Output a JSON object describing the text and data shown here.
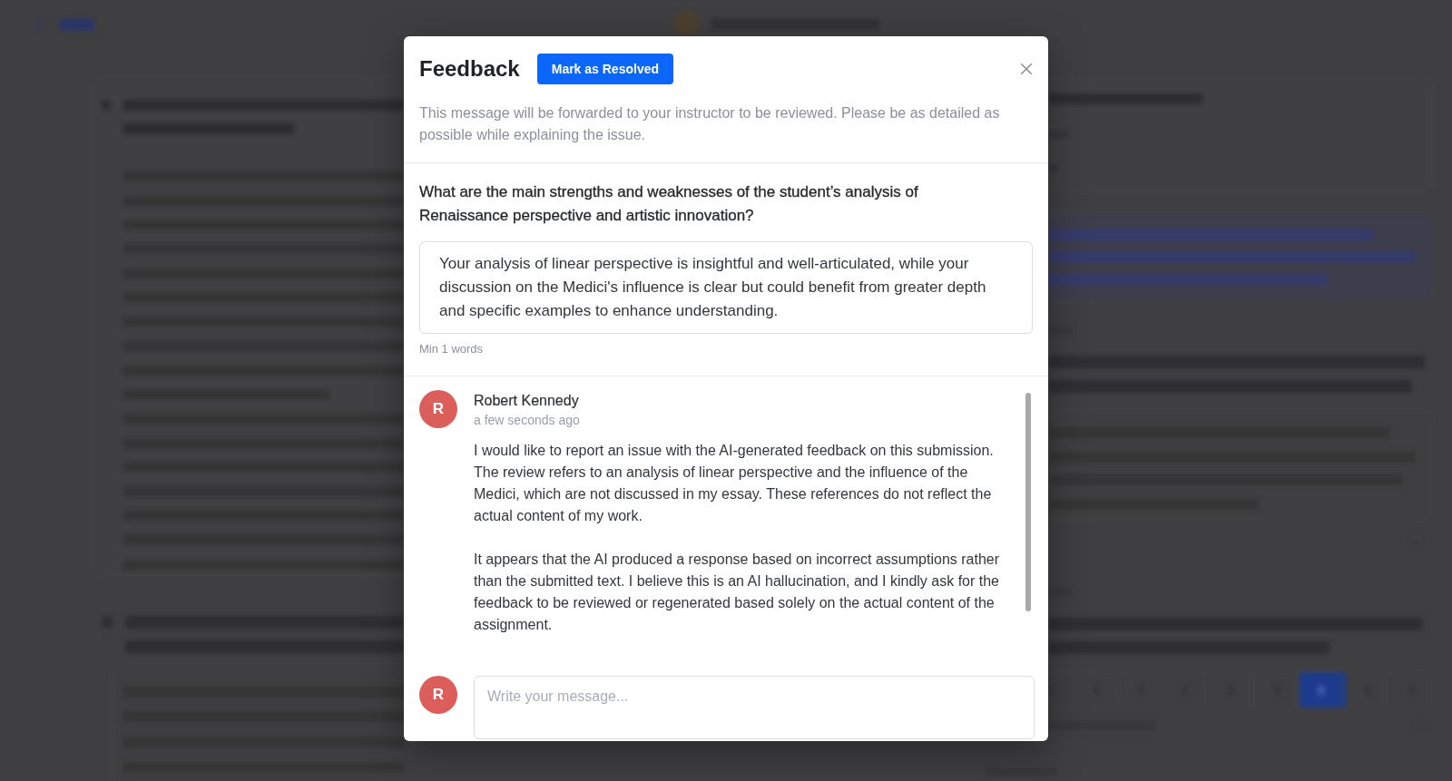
{
  "dialog": {
    "title": "Feedback",
    "resolve_button": "Mark as Resolved",
    "description": "This message will be forwarded to your instructor to be reviewed. Please be as detailed as possible while explaining the issue.",
    "question": "What are the main strengths and weaknesses of the student’s analysis of Renaissance perspective and artistic innovation?",
    "answer": "Your analysis of linear perspective is insightful and well-articulated, while your discussion on the Medici's influence is clear but could benefit from greater depth and specific examples to enhance understanding.",
    "answer_hint": "Min 1 words",
    "messages": [
      {
        "avatar": "R",
        "author": "Robert Kennedy",
        "time": "a few seconds ago",
        "paragraphs": [
          "I would like to report an issue with the AI-generated feedback on this submission. The review refers to an analysis of linear perspective and the influence of the Medici, which are not discussed in my essay. These references do not reflect the actual content of my work.",
          "It appears that the AI produced a response based on incorrect assumptions rather than the submitted text. I believe this is an AI hallucination, and I kindly ask for the feedback to be reviewed or regenerated based solely on the actual content of the assignment."
        ]
      }
    ],
    "composer": {
      "avatar": "R",
      "placeholder": "Write your message..."
    }
  }
}
